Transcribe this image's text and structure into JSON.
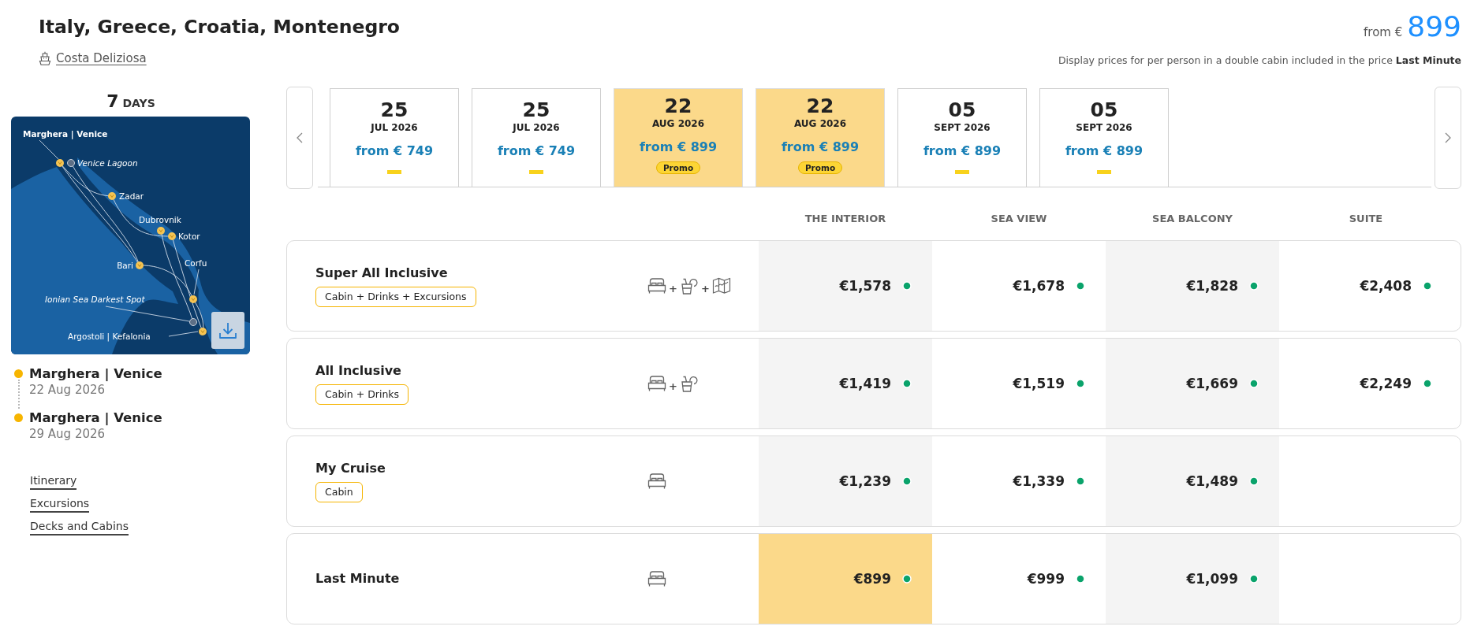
{
  "header": {
    "title": "Italy, Greece, Croatia, Montenegro",
    "ship": "Costa Deliziosa",
    "price_prefix": "from €",
    "price": "899",
    "note": "Display prices for per person in a double cabin included in the price **Last Minute**"
  },
  "duration": {
    "number": "7",
    "unit": "DAYS"
  },
  "map": {
    "ports": [
      {
        "name": "Marghera | Venice",
        "kind": "home"
      },
      {
        "name": "Venice Lagoon",
        "kind": "scenic"
      },
      {
        "name": "Zadar",
        "kind": "port"
      },
      {
        "name": "Dubrovnik",
        "kind": "port"
      },
      {
        "name": "Kotor",
        "kind": "port"
      },
      {
        "name": "Bari",
        "kind": "port"
      },
      {
        "name": "Corfu",
        "kind": "port"
      },
      {
        "name": "Ionian Sea Darkest Spot",
        "kind": "scenic"
      },
      {
        "name": "Argostoli | Kefalonia",
        "kind": "port"
      }
    ]
  },
  "stops": [
    {
      "port": "Marghera | Venice",
      "date": "22 Aug 2026"
    },
    {
      "port": "Marghera | Venice",
      "date": "29 Aug 2026"
    }
  ],
  "links": [
    "Itinerary",
    "Excursions",
    "Decks and Cabins"
  ],
  "dates": [
    {
      "day": "25",
      "month": "JUL 2026",
      "price": "from € 749",
      "selected": false,
      "promo": false
    },
    {
      "day": "25",
      "month": "JUL 2026",
      "price": "from € 749",
      "selected": false,
      "promo": false
    },
    {
      "day": "22",
      "month": "AUG 2026",
      "price": "from € 899",
      "selected": true,
      "promo": true,
      "badge": "Promo"
    },
    {
      "day": "22",
      "month": "AUG 2026",
      "price": "from € 899",
      "selected": true,
      "promo": true,
      "badge": "Promo"
    },
    {
      "day": "05",
      "month": "SEPT 2026",
      "price": "from € 899",
      "selected": false,
      "promo": false
    },
    {
      "day": "05",
      "month": "SEPT 2026",
      "price": "from € 899",
      "selected": false,
      "promo": false
    }
  ],
  "table": {
    "columns": [
      "THE INTERIOR",
      "SEA VIEW",
      "SEA BALCONY",
      "SUITE"
    ],
    "rows": [
      {
        "name": "Super All Inclusive",
        "tag": "Cabin + Drinks + Excursions",
        "includes": [
          {
            "kind": "cabin"
          },
          {
            "kind": "drinks",
            "joiner": "+"
          },
          {
            "kind": "excursions",
            "joiner": "+"
          }
        ],
        "prices": [
          {
            "value": "€1,578",
            "available": true,
            "selected": false
          },
          {
            "value": "€1,678",
            "available": true,
            "selected": false
          },
          {
            "value": "€1,828",
            "available": true,
            "selected": false
          },
          {
            "value": "€2,408",
            "available": true,
            "selected": false
          }
        ]
      },
      {
        "name": "All Inclusive",
        "tag": "Cabin + Drinks",
        "includes": [
          {
            "kind": "cabin"
          },
          {
            "kind": "drinks",
            "joiner": "+"
          }
        ],
        "prices": [
          {
            "value": "€1,419",
            "available": true,
            "selected": false
          },
          {
            "value": "€1,519",
            "available": true,
            "selected": false
          },
          {
            "value": "€1,669",
            "available": true,
            "selected": false
          },
          {
            "value": "€2,249",
            "available": true,
            "selected": false
          }
        ]
      },
      {
        "name": "My Cruise",
        "tag": "Cabin",
        "includes": [
          {
            "kind": "cabin"
          }
        ],
        "prices": [
          {
            "value": "€1,239",
            "available": true,
            "selected": false
          },
          {
            "value": "€1,339",
            "available": true,
            "selected": false
          },
          {
            "value": "€1,489",
            "available": true,
            "selected": false
          }
        ]
      },
      {
        "name": "Last Minute",
        "includes": [
          {
            "kind": "cabin"
          }
        ],
        "prices": [
          {
            "value": "€899",
            "available": true,
            "selected": true
          },
          {
            "value": "€999",
            "available": true,
            "selected": false
          },
          {
            "value": "€1,099",
            "available": true,
            "selected": false
          }
        ]
      }
    ]
  }
}
